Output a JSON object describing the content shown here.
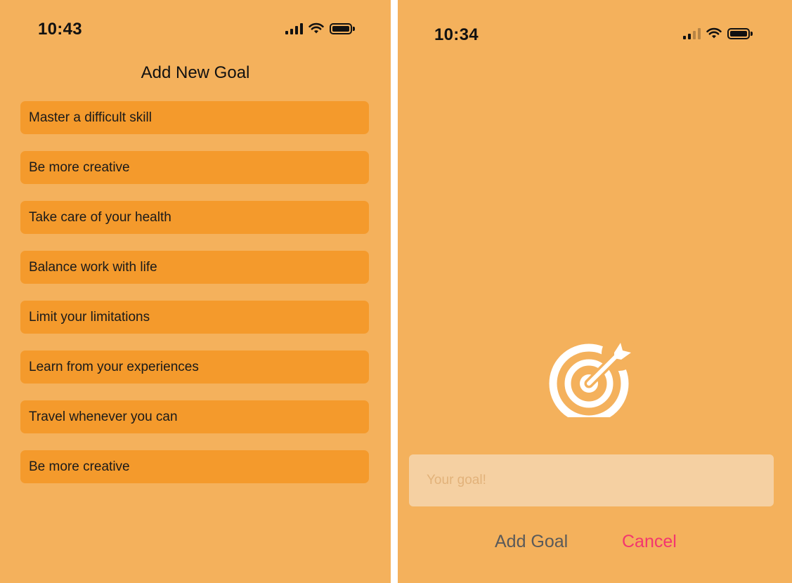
{
  "left_screen": {
    "status_time": "10:43",
    "title": "Add New Goal",
    "goals": [
      "Master a difficult skill",
      "Be more creative",
      "Take care of your health",
      "Balance work with life",
      "Limit your limitations",
      "Learn from your experiences",
      "Travel whenever you can",
      "Be more creative"
    ]
  },
  "right_screen": {
    "status_time": "10:34",
    "icon": "target-arrow-icon",
    "input_placeholder": "Your goal!",
    "input_value": "",
    "add_label": "Add Goal",
    "cancel_label": "Cancel"
  },
  "colors": {
    "background": "#F4B15C",
    "goal_item": "#F49A2C",
    "input_background": "#F5D0A2",
    "cancel": "#F3366F"
  }
}
